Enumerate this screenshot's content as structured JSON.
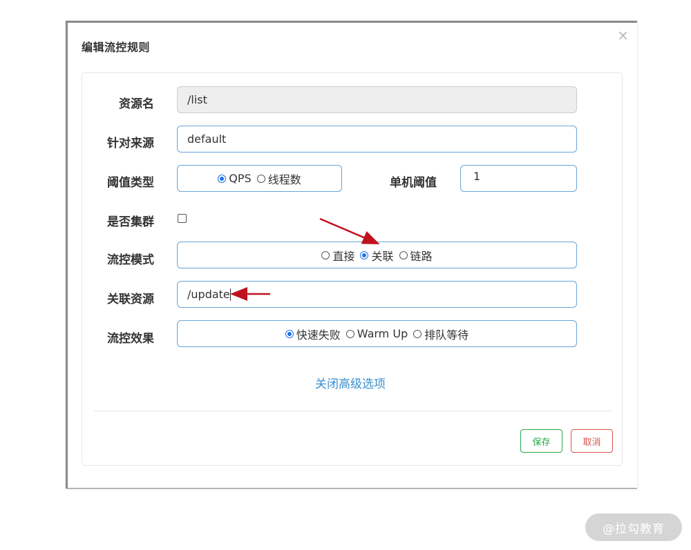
{
  "dialog": {
    "title": "编辑流控规则",
    "close_glyph": "×"
  },
  "form": {
    "resource_name": {
      "label": "资源名",
      "value": "/list"
    },
    "limit_app": {
      "label": "针对来源",
      "value": "default"
    },
    "grade": {
      "label": "阈值类型",
      "options": [
        "QPS",
        "线程数"
      ],
      "selected": "QPS"
    },
    "count": {
      "label": "单机阈值",
      "value": "1"
    },
    "cluster_mode": {
      "label": "是否集群",
      "checked": false
    },
    "strategy": {
      "label": "流控模式",
      "options": [
        "直接",
        "关联",
        "链路"
      ],
      "selected": "关联"
    },
    "ref_resource": {
      "label": "关联资源",
      "value": "/update"
    },
    "control_behavior": {
      "label": "流控效果",
      "options": [
        "快速失败",
        "Warm Up",
        "排队等待"
      ],
      "selected": "快速失败"
    },
    "advanced_toggle": "关闭高级选项"
  },
  "footer": {
    "save_label": "保存",
    "cancel_label": "取消"
  },
  "annotations": {
    "arrow_color": "#c0111f"
  },
  "colors": {
    "accent": "#1a73e8",
    "link": "#3a8fd0",
    "save": "#27a745",
    "cancel": "#d9534f",
    "input_border": "#66a4d8"
  },
  "watermark": "@拉勾教育"
}
